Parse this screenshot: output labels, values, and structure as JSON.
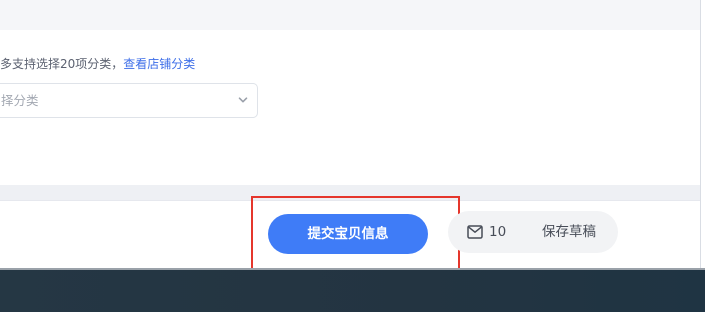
{
  "category": {
    "hint_text": "多支持选择20项分类，",
    "hint_link": "查看店铺分类",
    "placeholder": "择分类"
  },
  "actions": {
    "submit_label": "提交宝贝信息",
    "draft_count": "10",
    "save_draft_label": "保存草稿"
  },
  "icons": {
    "select_arrow": "chevron-down-icon",
    "drafts": "mail-icon"
  },
  "colors": {
    "primary": "#3f7cf7",
    "link": "#3d6ee8",
    "highlight": "#e5362c",
    "footer": "#253744"
  }
}
